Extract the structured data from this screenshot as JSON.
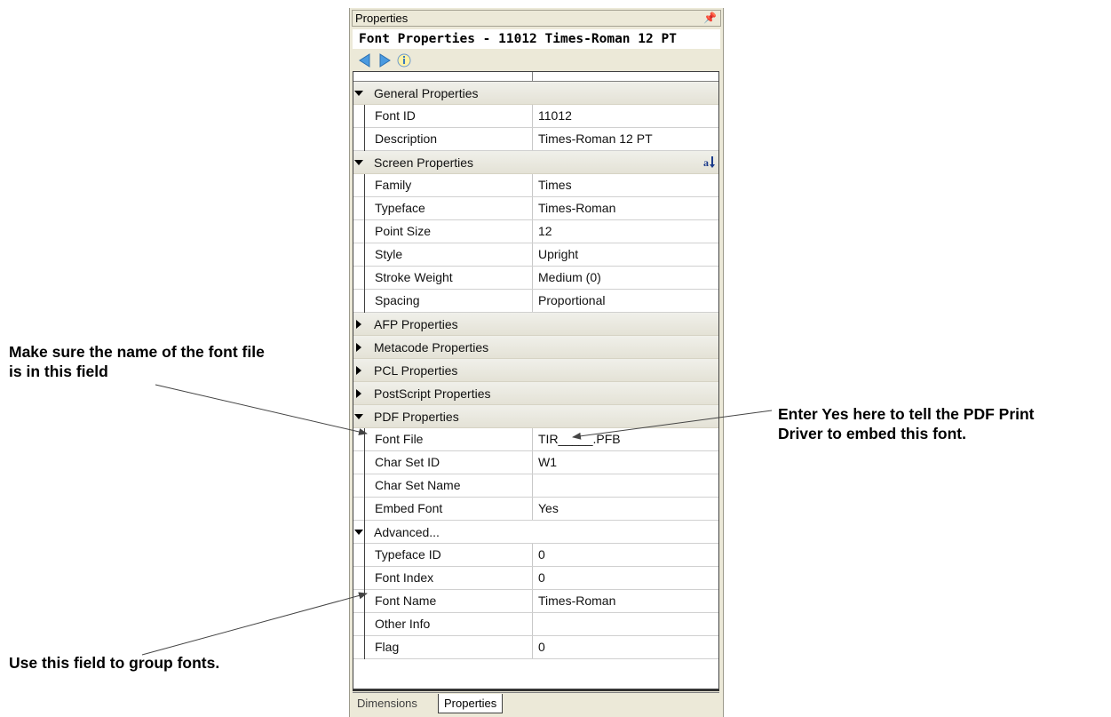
{
  "panel": {
    "title": "Properties",
    "pin_glyph": "ᶨ",
    "header": "Font Properties - 11012  Times-Roman 12 PT"
  },
  "toolbar": {
    "icons": [
      "back-arrow-icon",
      "forward-arrow-icon",
      "info-icon"
    ]
  },
  "groups": {
    "general": {
      "label": "General Properties",
      "rows": [
        {
          "name": "Font ID",
          "value": "11012"
        },
        {
          "name": "Description",
          "value": "Times-Roman 12 PT"
        }
      ]
    },
    "screen": {
      "label": "Screen Properties",
      "rows": [
        {
          "name": "Family",
          "value": "Times"
        },
        {
          "name": "Typeface",
          "value": "Times-Roman"
        },
        {
          "name": "Point Size",
          "value": "12"
        },
        {
          "name": "Style",
          "value": "Upright"
        },
        {
          "name": "Stroke Weight",
          "value": "Medium (0)"
        },
        {
          "name": "Spacing",
          "value": "Proportional"
        }
      ]
    },
    "afp": {
      "label": "AFP Properties"
    },
    "metacode": {
      "label": "Metacode Properties"
    },
    "pcl": {
      "label": "PCL Properties"
    },
    "postscript": {
      "label": "PostScript Properties"
    },
    "pdf": {
      "label": "PDF Properties",
      "rows": [
        {
          "name": "Font File",
          "value": "TIR_____.PFB"
        },
        {
          "name": "Char Set ID",
          "value": "W1"
        },
        {
          "name": "Char Set Name",
          "value": ""
        },
        {
          "name": "Embed Font",
          "value": "Yes"
        }
      ]
    },
    "advanced": {
      "label": "Advanced...",
      "rows": [
        {
          "name": "Typeface ID",
          "value": "0"
        },
        {
          "name": "Font Index",
          "value": "0"
        },
        {
          "name": "Font Name",
          "value": "Times-Roman"
        },
        {
          "name": "Other Info",
          "value": ""
        },
        {
          "name": "Flag",
          "value": "0"
        }
      ]
    }
  },
  "tabs": [
    "Dimensions",
    "Properties"
  ],
  "callouts": {
    "font_file": "Make sure the name of the font file\nis in this field",
    "embed": "Enter Yes here to tell the PDF Print\nDriver to embed this font.",
    "group": "Use this field to group fonts."
  },
  "colors": {
    "panel_bg": "#ece9d8",
    "back_icon": "#3a8fd8",
    "forward_icon": "#3a8fd8"
  }
}
